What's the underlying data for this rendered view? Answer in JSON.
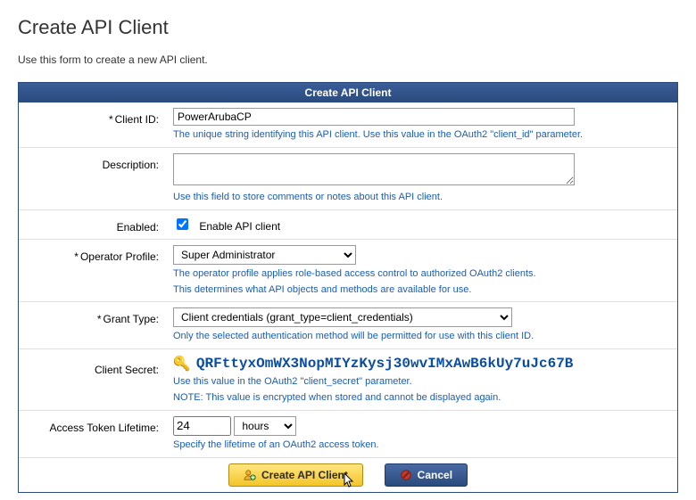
{
  "page": {
    "title": "Create API Client",
    "intro": "Use this form to create a new API client."
  },
  "panel": {
    "heading": "Create API Client"
  },
  "labels": {
    "client_id": "Client ID:",
    "description": "Description:",
    "enabled": "Enabled:",
    "operator_profile": "Operator Profile:",
    "grant_type": "Grant Type:",
    "client_secret": "Client Secret:",
    "access_token_lifetime": "Access Token Lifetime:",
    "req": "*"
  },
  "fields": {
    "client_id": {
      "value": "PowerArubaCP",
      "hint": "The unique string identifying this API client. Use this value in the OAuth2 \"client_id\" parameter."
    },
    "description": {
      "value": "",
      "hint": "Use this field to store comments or notes about this API client."
    },
    "enabled": {
      "checked": true,
      "label": "Enable API client"
    },
    "operator_profile": {
      "selected": "Super Administrator",
      "hint1": "The operator profile applies role-based access control to authorized OAuth2 clients.",
      "hint2": "This determines what API objects and methods are available for use."
    },
    "grant_type": {
      "selected": "Client credentials (grant_type=client_credentials)",
      "hint": "Only the selected authentication method will be permitted for use with this client ID."
    },
    "client_secret": {
      "value": "QRFttyxOmWX3NopMIYzKysj30wvIMxAwB6kUy7uJc67B",
      "hint1": "Use this value in the OAuth2 \"client_secret\" parameter.",
      "hint2": "NOTE: This value is encrypted when stored and cannot be displayed again."
    },
    "access_token_lifetime": {
      "value": "24",
      "unit": "hours",
      "hint": "Specify the lifetime of an OAuth2 access token."
    }
  },
  "buttons": {
    "create": "Create API Client",
    "cancel": "Cancel"
  }
}
